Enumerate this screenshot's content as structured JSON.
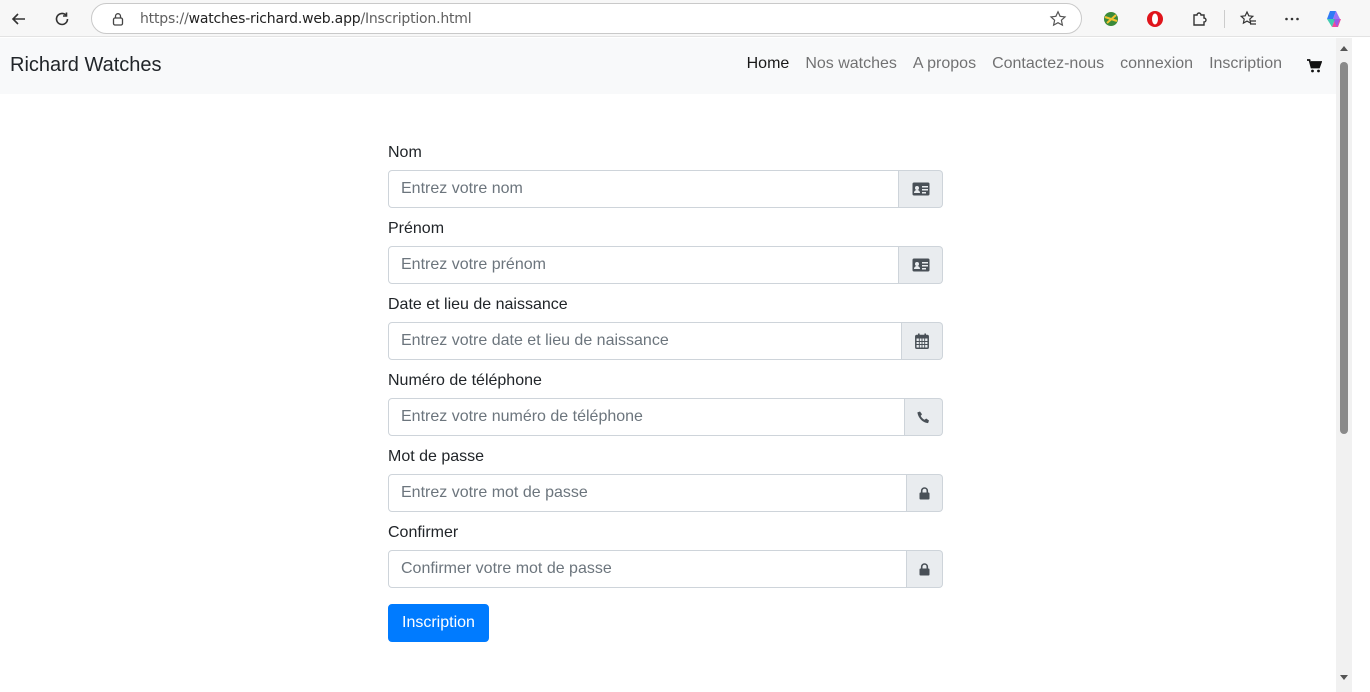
{
  "browser": {
    "url_prefix": "https://",
    "url_host": "watches-richard.web.app",
    "url_path": "/Inscription.html"
  },
  "navbar": {
    "brand": "Richard Watches",
    "links": [
      "Home",
      "Nos watches",
      "A propos",
      "Contactez-nous",
      "connexion",
      "Inscription"
    ],
    "active_link": "Home",
    "cart_icon": "shopping-cart-icon"
  },
  "form": {
    "fields": [
      {
        "label": "Nom",
        "placeholder": "Entrez votre nom",
        "icon": "id-card-icon"
      },
      {
        "label": "Prénom",
        "placeholder": "Entrez votre prénom",
        "icon": "id-card-icon"
      },
      {
        "label": "Date et lieu de naissance",
        "placeholder": "Entrez votre date et lieu de naissance",
        "icon": "calendar-icon"
      },
      {
        "label": "Numéro de téléphone",
        "placeholder": "Entrez votre numéro de téléphone",
        "icon": "phone-icon"
      },
      {
        "label": "Mot de passe",
        "placeholder": "Entrez votre mot de passe",
        "icon": "lock-icon"
      },
      {
        "label": "Confirmer",
        "placeholder": "Confirmer votre mot de passe",
        "icon": "lock-icon"
      }
    ],
    "submit_label": "Inscription"
  },
  "colors": {
    "primary": "#007bff",
    "navbar_bg": "#f8f9fa",
    "addon_bg": "#e9ecef"
  }
}
